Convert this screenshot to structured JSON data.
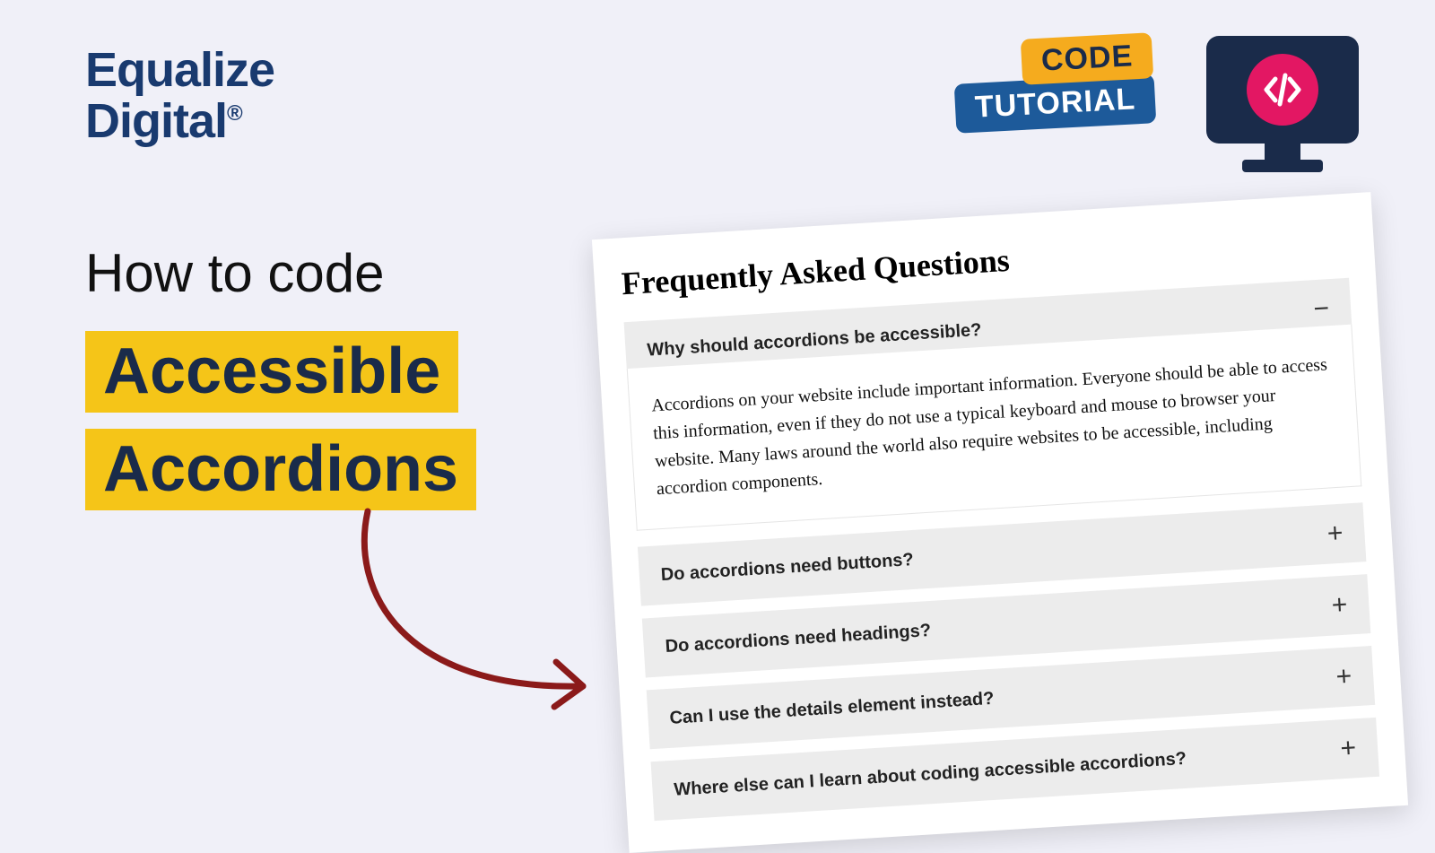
{
  "logo": {
    "line1": "Equalize",
    "line2": "Digital",
    "registered": "®"
  },
  "badges": {
    "code": "CODE",
    "tutorial": "TUTORIAL"
  },
  "title": {
    "intro": "How to code",
    "line1": "Accessible",
    "line2": "Accordions"
  },
  "faq": {
    "heading": "Frequently Asked Questions",
    "items": [
      {
        "question": "Why should accordions be accessible?",
        "expanded": true,
        "toggle": "−",
        "answer": "Accordions on your website include important information. Everyone should be able to access this information, even if they do not use a typical keyboard and mouse to browser your website. Many laws around the world also require websites to be accessible, including accordion components."
      },
      {
        "question": "Do accordions need buttons?",
        "expanded": false,
        "toggle": "+"
      },
      {
        "question": "Do accordions need headings?",
        "expanded": false,
        "toggle": "+"
      },
      {
        "question": "Can I use the details element instead?",
        "expanded": false,
        "toggle": "+"
      },
      {
        "question": "Where else can I learn about coding accessible accordions?",
        "expanded": false,
        "toggle": "+"
      }
    ]
  },
  "icons": {
    "code_slash": "code-slash-icon",
    "arrow": "curved-arrow-icon"
  },
  "colors": {
    "bg": "#f0f0f8",
    "navy": "#1a2b4a",
    "logo_blue": "#193a6f",
    "blue": "#1d5a9a",
    "yellow": "#f5c518",
    "orange": "#f5ab1e",
    "pink": "#e31763",
    "arrow_red": "#8b1a1a"
  }
}
